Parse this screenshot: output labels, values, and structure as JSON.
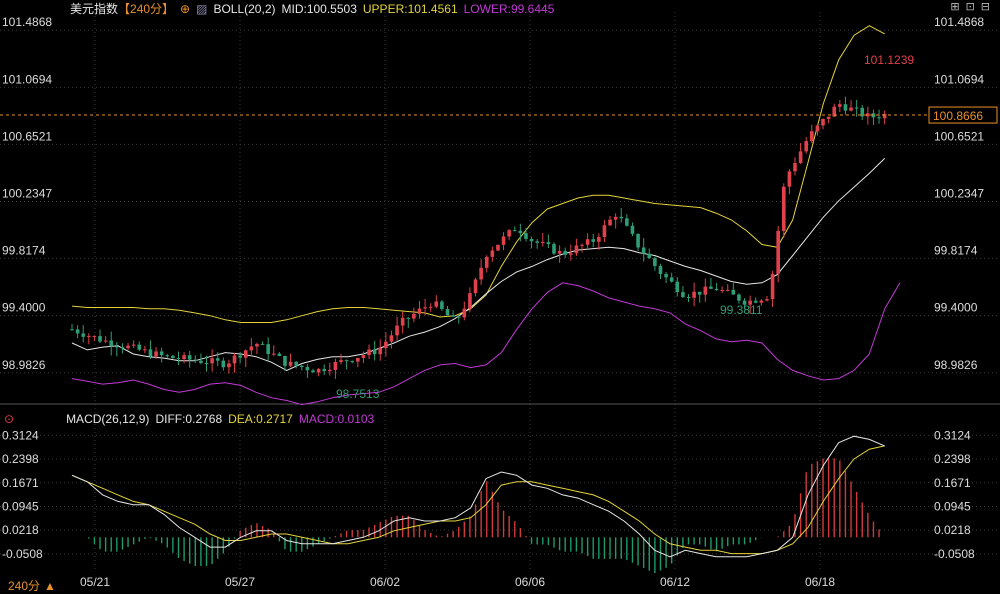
{
  "colors": {
    "background": "#000000",
    "grid": "#3a3a3a",
    "up": "#e0414d",
    "down": "#2e9e76",
    "mid": "#e6e6e6",
    "upper": "#e3d33b",
    "lower": "#c23ad6",
    "price_line": "#e8902a",
    "axis_text": "#dcdcdc",
    "macd_pos": "#d03a3a",
    "macd_neg": "#1f9a6a"
  },
  "header": {
    "symbol": "美元指数",
    "period": "【240分】",
    "period_icon": "crosshair-circle-icon",
    "indicator": "BOLL(20,2)",
    "mid_label": "MID:100.5503",
    "upper_label": "UPPER:101.4561",
    "lower_label": "LOWER:99.6445"
  },
  "window_controls": [
    "maximize-icon",
    "restore-icon",
    "settings-icon"
  ],
  "macd_header": {
    "icon": "settings-dot-icon",
    "name": "MACD(26,12,9)",
    "diff": "DIFF:0.2768",
    "dea": "DEA:0.2717",
    "macd": "MACD:0.0103"
  },
  "footer": {
    "period_selector": "240分",
    "arrow": "▲"
  },
  "chart_data": [
    {
      "type": "candlestick",
      "panel": "price",
      "y_ticks": [
        "101.4868",
        "101.0694",
        "100.6521",
        "100.2347",
        "99.8174",
        "99.4000",
        "98.9826"
      ],
      "ylim": [
        98.82,
        101.62
      ],
      "x_ticks": [
        "05/21",
        "05/27",
        "06/02",
        "06/06",
        "06/12",
        "06/18"
      ],
      "current_price": "100.8666",
      "annotations": [
        {
          "label": "101.1239",
          "value": 101.1239,
          "color": "#e0414d",
          "anchor": "high"
        },
        {
          "label": "98.7513",
          "value": 98.7513,
          "color": "#2e9e76",
          "anchor": "low"
        },
        {
          "label": "99.3811",
          "value": 99.3811,
          "color": "#2e9e76",
          "anchor": "low"
        }
      ],
      "bars": 146,
      "mid_path": [
        [
          0,
          99.2
        ],
        [
          10,
          99.15
        ],
        [
          20,
          99.17
        ],
        [
          30,
          99.18
        ],
        [
          40,
          99.12
        ],
        [
          50,
          99.1
        ],
        [
          60,
          99.09
        ],
        [
          70,
          99.07
        ],
        [
          80,
          99.07
        ],
        [
          90,
          99.1
        ],
        [
          100,
          99.13
        ],
        [
          110,
          99.12
        ],
        [
          120,
          99.1
        ],
        [
          130,
          99.06
        ],
        [
          140,
          99.0
        ],
        [
          150,
          99.05
        ],
        [
          160,
          99.08
        ],
        [
          170,
          99.1
        ],
        [
          180,
          99.1
        ],
        [
          190,
          99.12
        ],
        [
          200,
          99.16
        ],
        [
          210,
          99.2
        ],
        [
          220,
          99.25
        ],
        [
          230,
          99.28
        ],
        [
          240,
          99.32
        ],
        [
          250,
          99.38
        ],
        [
          260,
          99.46
        ],
        [
          270,
          99.56
        ],
        [
          280,
          99.65
        ],
        [
          290,
          99.72
        ],
        [
          300,
          99.76
        ],
        [
          310,
          99.81
        ],
        [
          320,
          99.85
        ],
        [
          330,
          99.88
        ],
        [
          340,
          99.89
        ],
        [
          350,
          99.9
        ],
        [
          360,
          99.89
        ],
        [
          370,
          99.86
        ],
        [
          380,
          99.84
        ],
        [
          390,
          99.8
        ],
        [
          400,
          99.76
        ],
        [
          410,
          99.73
        ],
        [
          420,
          99.69
        ],
        [
          430,
          99.65
        ],
        [
          440,
          99.63
        ],
        [
          450,
          99.64
        ],
        [
          460,
          99.7
        ],
        [
          470,
          99.84
        ],
        [
          480,
          99.98
        ],
        [
          490,
          100.12
        ],
        [
          500,
          100.24
        ],
        [
          510,
          100.34
        ],
        [
          520,
          100.44
        ],
        [
          530,
          100.55
        ]
      ],
      "upper_path": [
        [
          0,
          99.47
        ],
        [
          10,
          99.46
        ],
        [
          20,
          99.46
        ],
        [
          30,
          99.46
        ],
        [
          40,
          99.46
        ],
        [
          50,
          99.45
        ],
        [
          60,
          99.45
        ],
        [
          70,
          99.44
        ],
        [
          80,
          99.42
        ],
        [
          90,
          99.4
        ],
        [
          100,
          99.37
        ],
        [
          110,
          99.35
        ],
        [
          120,
          99.35
        ],
        [
          130,
          99.35
        ],
        [
          140,
          99.37
        ],
        [
          150,
          99.4
        ],
        [
          160,
          99.43
        ],
        [
          170,
          99.45
        ],
        [
          180,
          99.46
        ],
        [
          190,
          99.46
        ],
        [
          200,
          99.45
        ],
        [
          210,
          99.44
        ],
        [
          220,
          99.43
        ],
        [
          230,
          99.42
        ],
        [
          240,
          99.39
        ],
        [
          250,
          99.4
        ],
        [
          260,
          99.45
        ],
        [
          270,
          99.55
        ],
        [
          280,
          99.76
        ],
        [
          290,
          99.94
        ],
        [
          300,
          100.08
        ],
        [
          310,
          100.18
        ],
        [
          320,
          100.22
        ],
        [
          330,
          100.26
        ],
        [
          340,
          100.28
        ],
        [
          350,
          100.28
        ],
        [
          360,
          100.26
        ],
        [
          370,
          100.24
        ],
        [
          380,
          100.22
        ],
        [
          390,
          100.21
        ],
        [
          400,
          100.2
        ],
        [
          410,
          100.19
        ],
        [
          420,
          100.15
        ],
        [
          430,
          100.1
        ],
        [
          440,
          100.02
        ],
        [
          450,
          99.92
        ],
        [
          460,
          99.9
        ],
        [
          470,
          100.1
        ],
        [
          480,
          100.52
        ],
        [
          490,
          100.95
        ],
        [
          500,
          101.27
        ],
        [
          510,
          101.45
        ],
        [
          520,
          101.52
        ],
        [
          530,
          101.46
        ]
      ],
      "lower_path": [
        [
          0,
          98.94
        ],
        [
          10,
          98.92
        ],
        [
          20,
          98.9
        ],
        [
          30,
          98.91
        ],
        [
          40,
          98.93
        ],
        [
          50,
          98.9
        ],
        [
          60,
          98.86
        ],
        [
          70,
          98.84
        ],
        [
          80,
          98.86
        ],
        [
          90,
          98.9
        ],
        [
          100,
          98.91
        ],
        [
          110,
          98.89
        ],
        [
          120,
          98.84
        ],
        [
          130,
          98.8
        ],
        [
          140,
          98.78
        ],
        [
          150,
          98.75
        ],
        [
          160,
          98.77
        ],
        [
          170,
          98.8
        ],
        [
          180,
          98.82
        ],
        [
          190,
          98.83
        ],
        [
          200,
          98.84
        ],
        [
          210,
          98.88
        ],
        [
          220,
          98.94
        ],
        [
          230,
          99.0
        ],
        [
          240,
          99.04
        ],
        [
          250,
          99.05
        ],
        [
          260,
          99.02
        ],
        [
          270,
          99.04
        ],
        [
          280,
          99.13
        ],
        [
          290,
          99.3
        ],
        [
          300,
          99.45
        ],
        [
          310,
          99.57
        ],
        [
          320,
          99.64
        ],
        [
          330,
          99.62
        ],
        [
          340,
          99.58
        ],
        [
          350,
          99.53
        ],
        [
          360,
          99.5
        ],
        [
          370,
          99.47
        ],
        [
          380,
          99.45
        ],
        [
          390,
          99.42
        ],
        [
          400,
          99.34
        ],
        [
          410,
          99.29
        ],
        [
          420,
          99.23
        ],
        [
          430,
          99.21
        ],
        [
          440,
          99.22
        ],
        [
          450,
          99.2
        ],
        [
          460,
          99.08
        ],
        [
          470,
          99.0
        ],
        [
          480,
          98.96
        ],
        [
          490,
          98.93
        ],
        [
          500,
          98.94
        ],
        [
          510,
          99.0
        ],
        [
          520,
          99.12
        ],
        [
          530,
          99.45
        ],
        [
          540,
          99.64
        ]
      ]
    },
    {
      "type": "macd",
      "panel": "macd",
      "y_ticks": [
        "0.3124",
        "0.2398",
        "0.1671",
        "0.0945",
        "0.0218",
        "-0.0508"
      ],
      "ylim": [
        -0.085,
        0.335
      ],
      "diff_path": [
        [
          0,
          0.19
        ],
        [
          10,
          0.17
        ],
        [
          20,
          0.13
        ],
        [
          30,
          0.11
        ],
        [
          40,
          0.1
        ],
        [
          50,
          0.1
        ],
        [
          60,
          0.07
        ],
        [
          70,
          0.03
        ],
        [
          80,
          0.0
        ],
        [
          90,
          -0.03
        ],
        [
          100,
          -0.03
        ],
        [
          110,
          0.0
        ],
        [
          120,
          0.02
        ],
        [
          130,
          0.02
        ],
        [
          140,
          -0.01
        ],
        [
          150,
          -0.02
        ],
        [
          160,
          -0.02
        ],
        [
          170,
          -0.02
        ],
        [
          180,
          -0.01
        ],
        [
          190,
          0.0
        ],
        [
          200,
          0.02
        ],
        [
          210,
          0.05
        ],
        [
          220,
          0.06
        ],
        [
          230,
          0.05
        ],
        [
          240,
          0.05
        ],
        [
          250,
          0.06
        ],
        [
          260,
          0.09
        ],
        [
          270,
          0.18
        ],
        [
          280,
          0.2
        ],
        [
          290,
          0.19
        ],
        [
          300,
          0.16
        ],
        [
          310,
          0.15
        ],
        [
          320,
          0.13
        ],
        [
          330,
          0.12
        ],
        [
          340,
          0.1
        ],
        [
          350,
          0.08
        ],
        [
          360,
          0.05
        ],
        [
          370,
          0.01
        ],
        [
          380,
          -0.04
        ],
        [
          390,
          -0.06
        ],
        [
          400,
          -0.04
        ],
        [
          410,
          -0.05
        ],
        [
          420,
          -0.06
        ],
        [
          430,
          -0.06
        ],
        [
          440,
          -0.06
        ],
        [
          450,
          -0.05
        ],
        [
          460,
          -0.04
        ],
        [
          470,
          0.0
        ],
        [
          480,
          0.13
        ],
        [
          490,
          0.22
        ],
        [
          500,
          0.29
        ],
        [
          510,
          0.31
        ],
        [
          520,
          0.3
        ],
        [
          530,
          0.28
        ]
      ],
      "dea_path": [
        [
          0,
          0.19
        ],
        [
          10,
          0.17
        ],
        [
          20,
          0.15
        ],
        [
          30,
          0.13
        ],
        [
          40,
          0.11
        ],
        [
          50,
          0.1
        ],
        [
          60,
          0.08
        ],
        [
          70,
          0.06
        ],
        [
          80,
          0.04
        ],
        [
          90,
          0.01
        ],
        [
          100,
          -0.01
        ],
        [
          110,
          -0.01
        ],
        [
          120,
          0.0
        ],
        [
          130,
          0.01
        ],
        [
          140,
          0.01
        ],
        [
          150,
          0.0
        ],
        [
          160,
          -0.01
        ],
        [
          170,
          -0.02
        ],
        [
          180,
          -0.02
        ],
        [
          190,
          -0.01
        ],
        [
          200,
          0.0
        ],
        [
          210,
          0.02
        ],
        [
          220,
          0.03
        ],
        [
          230,
          0.04
        ],
        [
          240,
          0.05
        ],
        [
          250,
          0.05
        ],
        [
          260,
          0.06
        ],
        [
          270,
          0.1
        ],
        [
          280,
          0.16
        ],
        [
          290,
          0.17
        ],
        [
          300,
          0.17
        ],
        [
          310,
          0.16
        ],
        [
          320,
          0.15
        ],
        [
          330,
          0.14
        ],
        [
          340,
          0.13
        ],
        [
          350,
          0.11
        ],
        [
          360,
          0.08
        ],
        [
          370,
          0.05
        ],
        [
          380,
          0.01
        ],
        [
          390,
          -0.02
        ],
        [
          400,
          -0.03
        ],
        [
          410,
          -0.04
        ],
        [
          420,
          -0.04
        ],
        [
          430,
          -0.05
        ],
        [
          440,
          -0.05
        ],
        [
          450,
          -0.05
        ],
        [
          460,
          -0.04
        ],
        [
          470,
          -0.02
        ],
        [
          480,
          0.03
        ],
        [
          490,
          0.11
        ],
        [
          500,
          0.18
        ],
        [
          510,
          0.24
        ],
        [
          520,
          0.27
        ],
        [
          530,
          0.28
        ]
      ]
    }
  ]
}
